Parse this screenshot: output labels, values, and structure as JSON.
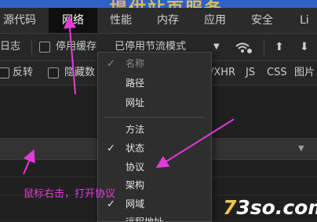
{
  "tabs": [
    "源代码",
    "网络",
    "性能",
    "内存",
    "应用",
    "安全",
    "Li"
  ],
  "active_tab": "网络",
  "banner_text": "提供站页服务",
  "toolbar": {
    "log_label": "日志",
    "disable_cache_label": "停用缓存",
    "throttle_label": "已停用节流模式"
  },
  "filters": {
    "invert_label": "反转",
    "hide_label": "隐藏数",
    "types": [
      "/XHR",
      "JS",
      "CSS",
      "图片"
    ]
  },
  "context_menu": {
    "items": [
      {
        "label": "名称",
        "checked": true,
        "disabled": true
      },
      {
        "label": "路径",
        "checked": false,
        "disabled": false
      },
      {
        "label": "网址",
        "checked": false,
        "disabled": false
      },
      {
        "label": "方法",
        "checked": false,
        "disabled": false
      },
      {
        "label": "状态",
        "checked": true,
        "disabled": false
      },
      {
        "label": "协议",
        "checked": false,
        "disabled": false
      },
      {
        "label": "架构",
        "checked": false,
        "disabled": false
      },
      {
        "label": "网域",
        "checked": true,
        "disabled": false
      },
      {
        "label": "远程地址",
        "checked": false,
        "disabled": false
      }
    ]
  },
  "annotation": "鼠标右击，打开协议",
  "watermark": {
    "digit": "7",
    "rest": "3so.com"
  },
  "colors": {
    "annotation": "#e23bd9",
    "active_tab": "#0f0f0f",
    "menu_bg": "#2e2e2e"
  }
}
